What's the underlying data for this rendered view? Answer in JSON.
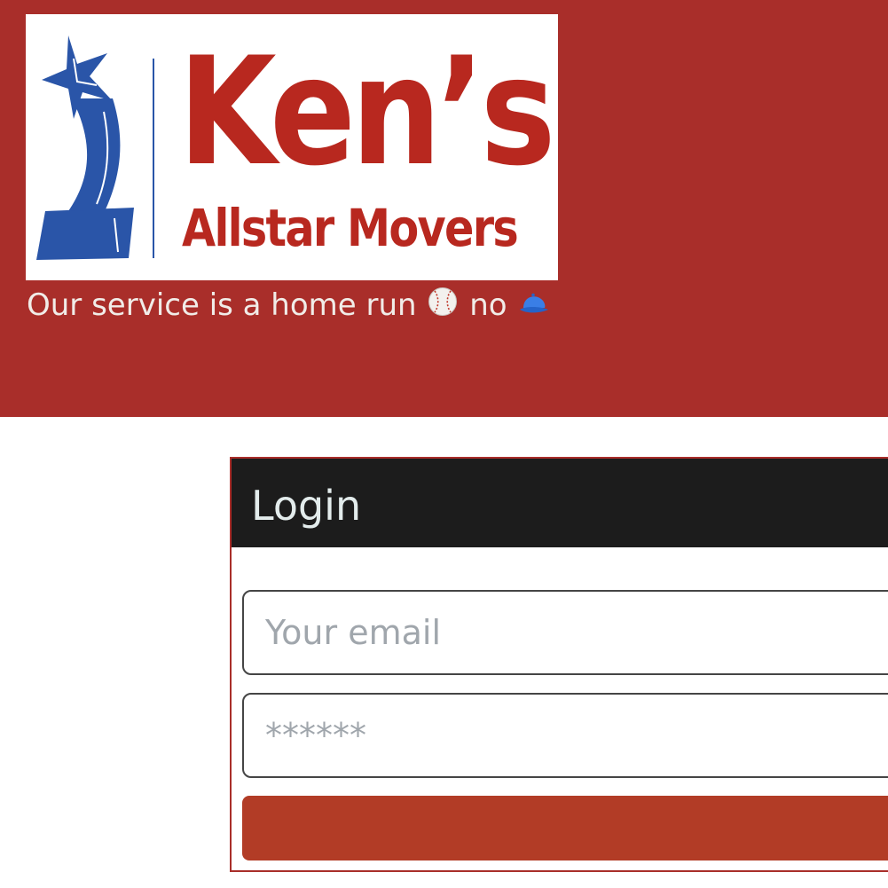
{
  "header": {
    "logo": {
      "name": "Ken’s",
      "subtitle": "Allstar Movers"
    },
    "tagline": {
      "text_1": "Our service is a home run",
      "text_2": "no",
      "emoji_1": "baseball-emoji",
      "emoji_2": "cap-emoji"
    }
  },
  "login": {
    "title": "Login",
    "email_placeholder": "Your email",
    "password_placeholder": "******",
    "submit_label": ""
  },
  "colors": {
    "brand_red": "#a92e2a",
    "logo_red": "#b8281f",
    "logo_blue": "#2a55a8",
    "card_header": "#1c1c1c",
    "button": "#b23c26"
  }
}
